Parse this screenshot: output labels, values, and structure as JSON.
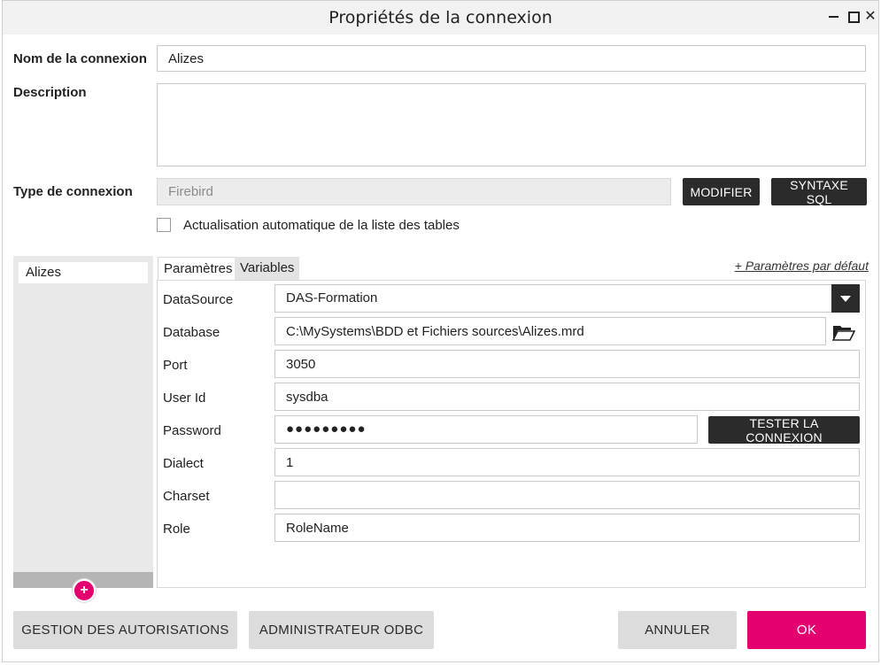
{
  "window": {
    "title": "Propriétés de la connexion"
  },
  "form": {
    "name_label": "Nom de la connexion",
    "name_value": "Alizes",
    "description_label": "Description",
    "description_value": "",
    "type_label": "Type de connexion",
    "type_value": "Firebird",
    "modify_label": "MODIFIER",
    "syntax_label": "SYNTAXE SQL",
    "auto_refresh_label": "Actualisation automatique de la liste des tables",
    "auto_refresh_checked": false
  },
  "connections": {
    "items": [
      {
        "label": "Alizes"
      }
    ],
    "add_icon": "plus-icon"
  },
  "tabs": {
    "params": "Paramètres",
    "variables": "Variables",
    "defaults_link": "+ Paramètres par défaut"
  },
  "params": {
    "datasource": {
      "label": "DataSource",
      "value": "DAS-Formation"
    },
    "database": {
      "label": "Database",
      "value": "C:\\MySystems\\BDD et Fichiers sources\\Alizes.mrd"
    },
    "port": {
      "label": "Port",
      "value": "3050"
    },
    "userid": {
      "label": "User Id",
      "value": "sysdba"
    },
    "password": {
      "label": "Password",
      "value": "●●●●●●●●●"
    },
    "test_label": "TESTER LA CONNEXION",
    "dialect": {
      "label": "Dialect",
      "value": "1"
    },
    "charset": {
      "label": "Charset",
      "value": ""
    },
    "role": {
      "label": "Role",
      "value": "RoleName"
    }
  },
  "footer": {
    "auth_label": "GESTION DES AUTORISATIONS",
    "odbc_label": "ADMINISTRATEUR ODBC",
    "cancel_label": "ANNULER",
    "ok_label": "OK"
  },
  "colors": {
    "accent": "#e5006f",
    "dark_button": "#2b2b2b",
    "gray_button": "#dcdcdc"
  }
}
